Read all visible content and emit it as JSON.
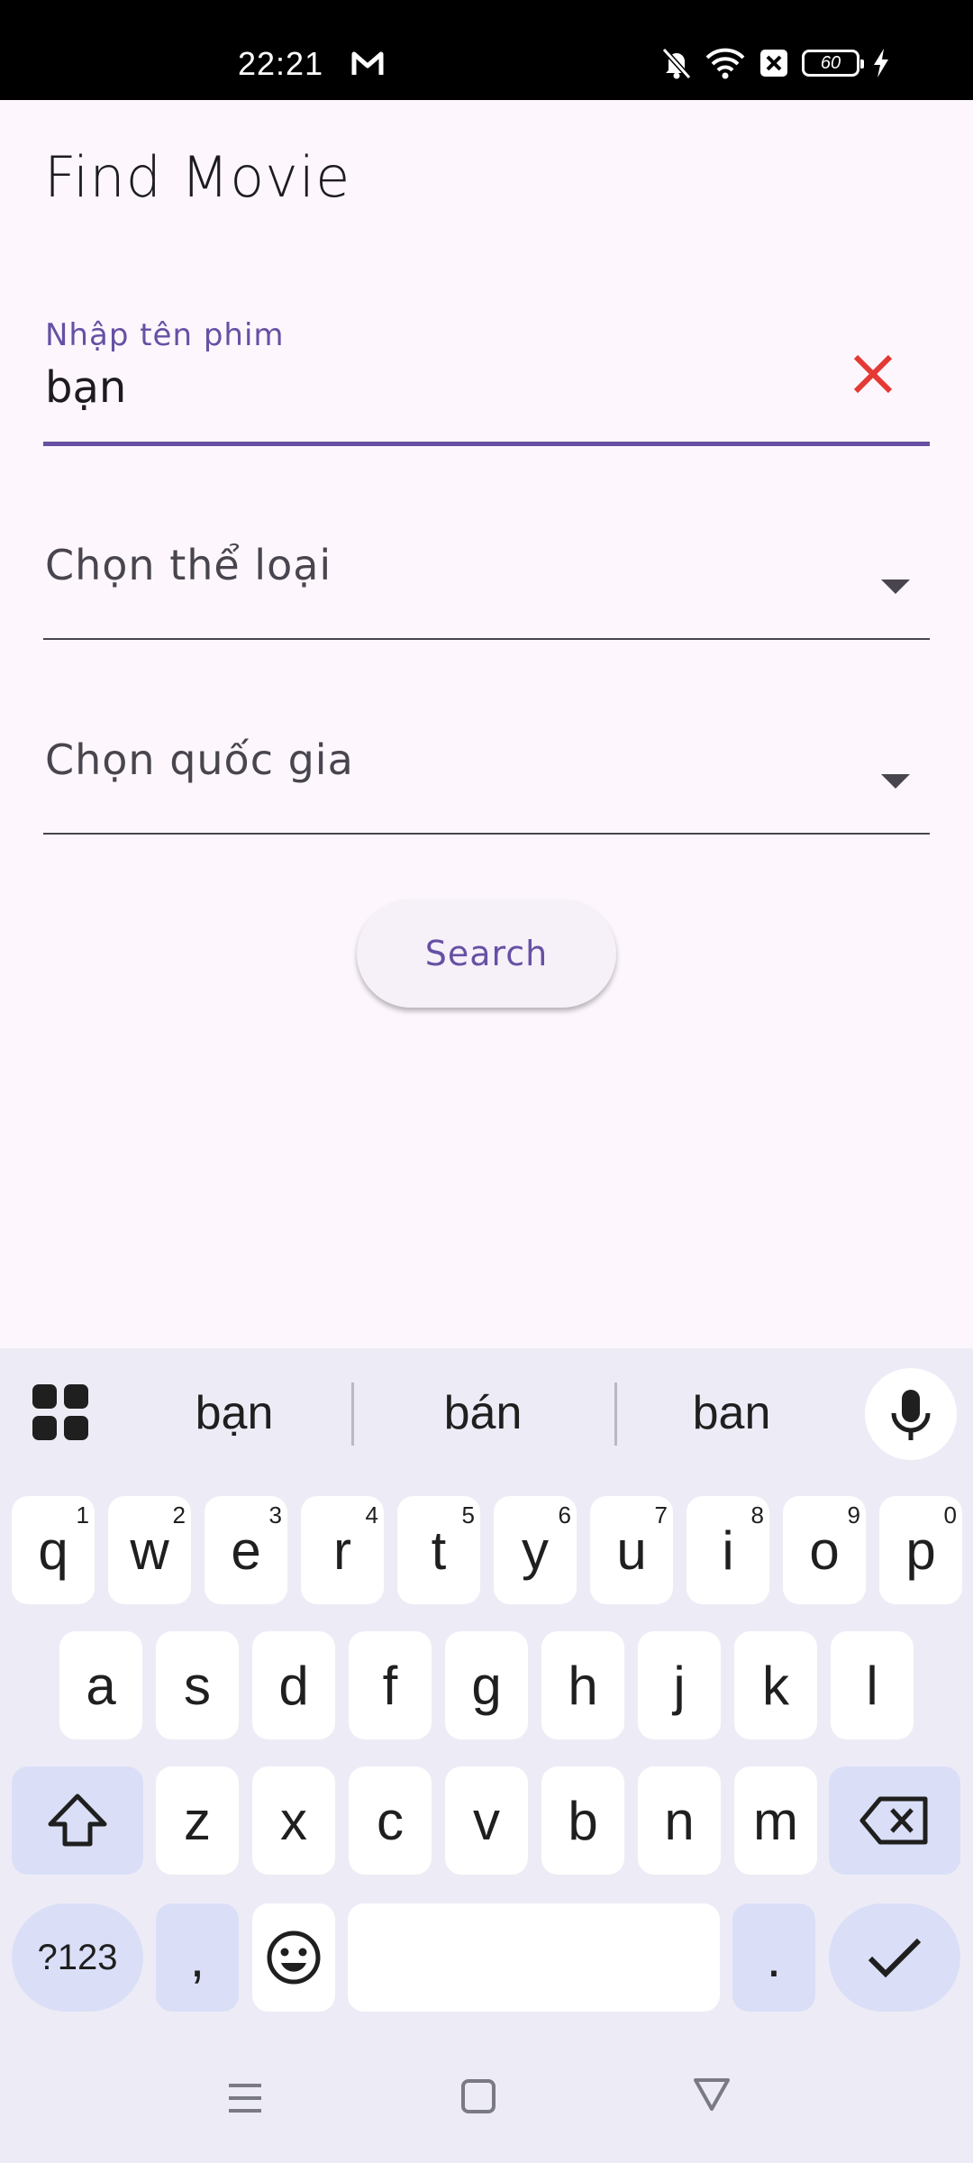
{
  "status_bar": {
    "time": "22:21",
    "battery": "60"
  },
  "app": {
    "title": "Find Movie",
    "movie_field": {
      "label": "Nhập tên phim",
      "value": "bạn"
    },
    "genre_dropdown": {
      "placeholder": "Chọn thể loại"
    },
    "country_dropdown": {
      "placeholder": "Chọn quốc gia"
    },
    "search_button": "Search",
    "colors": {
      "accent": "#6750a4",
      "clear": "#e53935",
      "background": "#fdf7fd"
    }
  },
  "keyboard": {
    "suggestions": [
      "bạn",
      "bán",
      "ban"
    ],
    "row1": [
      {
        "k": "q",
        "h": "1"
      },
      {
        "k": "w",
        "h": "2"
      },
      {
        "k": "e",
        "h": "3"
      },
      {
        "k": "r",
        "h": "4"
      },
      {
        "k": "t",
        "h": "5"
      },
      {
        "k": "y",
        "h": "6"
      },
      {
        "k": "u",
        "h": "7"
      },
      {
        "k": "i",
        "h": "8"
      },
      {
        "k": "o",
        "h": "9"
      },
      {
        "k": "p",
        "h": "0"
      }
    ],
    "row2": [
      "a",
      "s",
      "d",
      "f",
      "g",
      "h",
      "j",
      "k",
      "l"
    ],
    "row3": [
      "z",
      "x",
      "c",
      "v",
      "b",
      "n",
      "m"
    ],
    "symbols_key": "?123",
    "comma_key": ",",
    "period_key": "."
  }
}
